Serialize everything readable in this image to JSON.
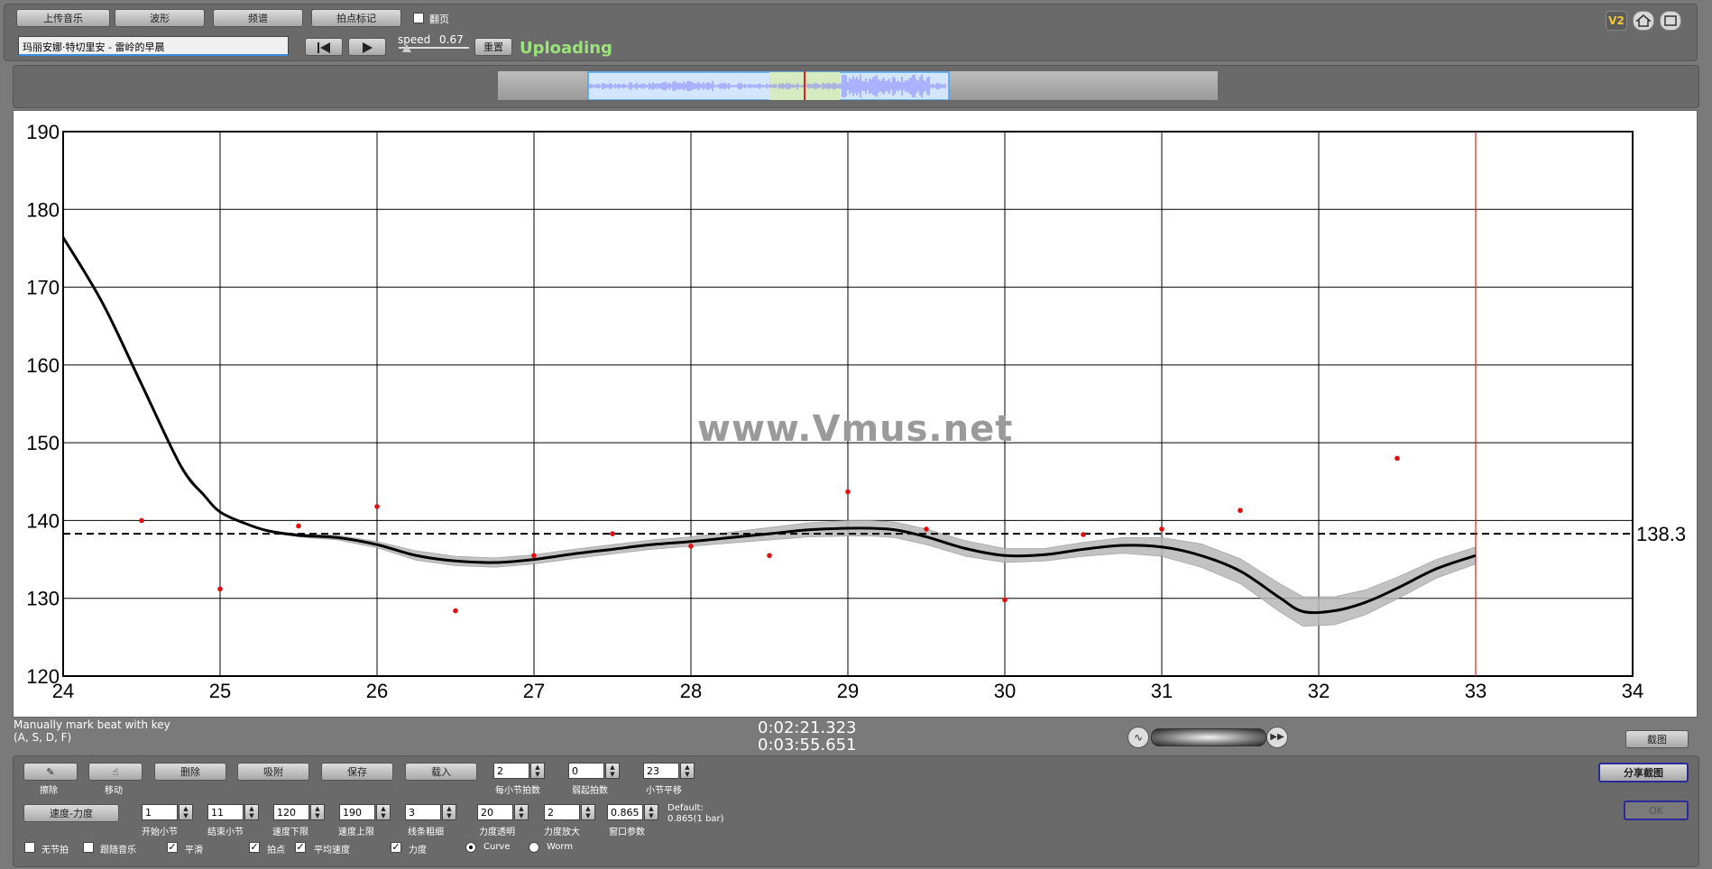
{
  "toolbar": {
    "upload_music": "上传音乐",
    "waveform": "波形",
    "spectrum": "频谱",
    "beat_mark": "拍点标记",
    "page_turn_label": "翻页",
    "song_title": "玛丽安娜·特切里安 - 雷岭的早晨",
    "speed_label": "speed",
    "speed_value": "0.67",
    "reset": "重置",
    "status": "Uploading"
  },
  "top_icons": {
    "v2": "V2",
    "home": "home-icon",
    "window": "window-icon"
  },
  "colors": {
    "status": "#9be37a",
    "red_line": "#e02020",
    "point": "#e01010",
    "curve": "#000000",
    "band": "#b8b8b8",
    "waveform": "#7f7fff"
  },
  "watermark": "www.Vmus.net",
  "chart_data": {
    "type": "line",
    "xlim": [
      24,
      34
    ],
    "ylim": [
      120,
      190
    ],
    "x_ticks": [
      "24",
      "25",
      "26",
      "27",
      "28",
      "29",
      "30",
      "31",
      "32",
      "33",
      "34"
    ],
    "y_ticks": [
      "120",
      "130",
      "140",
      "150",
      "160",
      "170",
      "180",
      "190"
    ],
    "grid": true,
    "average_line": {
      "value": 138.3,
      "label": "138.3"
    },
    "cursor_x": 33,
    "curve": {
      "x": [
        24,
        24.25,
        24.5,
        24.75,
        24.9,
        25,
        25.15,
        25.3,
        25.5,
        25.75,
        26,
        26.25,
        26.5,
        26.75,
        27,
        27.25,
        27.5,
        27.75,
        28,
        28.25,
        28.5,
        28.75,
        29,
        29.15,
        29.3,
        29.5,
        29.75,
        30,
        30.25,
        30.5,
        30.75,
        31,
        31.25,
        31.5,
        31.75,
        31.9,
        32.1,
        32.3,
        32.5,
        32.75,
        33
      ],
      "y": [
        176.4,
        168,
        157.5,
        147,
        143.2,
        141.1,
        139.7,
        138.7,
        138.1,
        137.8,
        136.9,
        135.5,
        134.8,
        134.6,
        135.0,
        135.7,
        136.3,
        136.9,
        137.3,
        137.8,
        138.3,
        138.8,
        139.0,
        139.0,
        138.8,
        137.9,
        136.4,
        135.5,
        135.6,
        136.3,
        136.8,
        136.6,
        135.5,
        133.5,
        130.1,
        128.3,
        128.4,
        129.5,
        131.3,
        133.8,
        135.5
      ]
    },
    "band_halfwidth": [
      0,
      0,
      0,
      0,
      0,
      0,
      0,
      0,
      0.2,
      0.3,
      0.4,
      0.6,
      0.6,
      0.6,
      0.6,
      0.6,
      0.6,
      0.6,
      0.6,
      0.7,
      0.8,
      0.9,
      1.0,
      1.0,
      1.0,
      1.0,
      1.0,
      0.9,
      0.8,
      0.9,
      1.0,
      1.2,
      1.5,
      1.6,
      1.8,
      1.9,
      1.8,
      1.6,
      1.4,
      1.2,
      1.1
    ],
    "points": [
      {
        "x": 24.5,
        "y": 140
      },
      {
        "x": 25,
        "y": 131.2
      },
      {
        "x": 25.5,
        "y": 139.3
      },
      {
        "x": 26,
        "y": 141.8
      },
      {
        "x": 26.5,
        "y": 128.4
      },
      {
        "x": 27,
        "y": 135.5
      },
      {
        "x": 27.5,
        "y": 138.3
      },
      {
        "x": 28,
        "y": 136.7
      },
      {
        "x": 28.5,
        "y": 135.5
      },
      {
        "x": 29,
        "y": 143.7
      },
      {
        "x": 29.5,
        "y": 138.9
      },
      {
        "x": 30,
        "y": 129.8
      },
      {
        "x": 30.5,
        "y": 138.2
      },
      {
        "x": 31,
        "y": 138.9
      },
      {
        "x": 31.5,
        "y": 141.3
      },
      {
        "x": 32.5,
        "y": 148
      }
    ]
  },
  "status_bar": {
    "hint_line1": "Manually mark beat with key",
    "hint_line2": "(A, S, D, F)",
    "time_current": "0:02:21.323",
    "time_total": "0:03:55.651",
    "screenshot": "截图"
  },
  "controls": {
    "erase": "擦除",
    "move": "移动",
    "delete": "删除",
    "snap": "吸附",
    "save": "保存",
    "load": "载入",
    "beats_per_bar_val": "2",
    "beats_per_bar": "每小节拍数",
    "weak_beat_val": "0",
    "weak_beat": "弱起拍数",
    "bar_shift_val": "23",
    "bar_shift": "小节平移",
    "share_screenshot": "分享截图",
    "tempo_dynamics": "速度-力度",
    "start_bar_val": "1",
    "start_bar": "开始小节",
    "end_bar_val": "11",
    "end_bar": "结束小节",
    "tempo_min_val": "120",
    "tempo_min": "速度下限",
    "tempo_max_val": "190",
    "tempo_max": "速度上限",
    "line_width_val": "3",
    "line_width": "线条粗细",
    "dyn_transp_val": "20",
    "dyn_transp": "力度透明",
    "dyn_scale_val": "2",
    "dyn_scale": "力度放大",
    "window_param_val": "0.865",
    "window_param": "窗口参数",
    "default_line1": "Default:",
    "default_line2": "0.865(1 bar)",
    "ok": "OK",
    "no_metronome": "无节拍",
    "follow_music": "跟随音乐",
    "smooth": "平滑",
    "beats": "拍点",
    "avg_tempo": "平均速度",
    "dynamics": "力度",
    "curve": "Curve",
    "worm": "Worm"
  }
}
